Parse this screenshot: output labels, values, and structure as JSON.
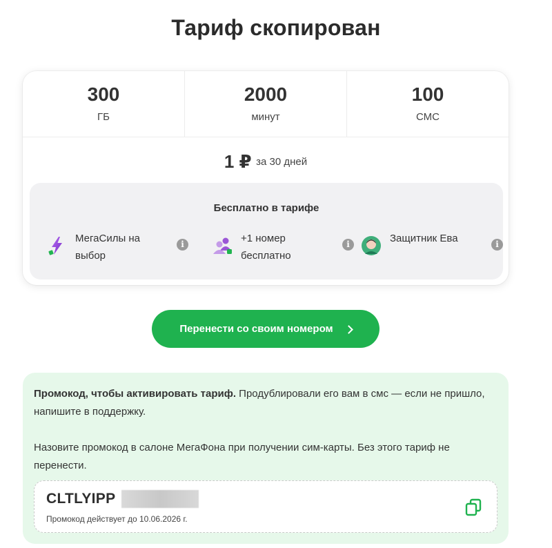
{
  "title": "Тариф скопирован",
  "stats": [
    {
      "value": "300",
      "unit": "ГБ"
    },
    {
      "value": "2000",
      "unit": "минут"
    },
    {
      "value": "100",
      "unit": "СМС"
    }
  ],
  "price": {
    "amount": "1 ₽",
    "period": "за 30 дней"
  },
  "free": {
    "title": "Бесплатно в тарифе",
    "features": [
      {
        "label": "МегаСилы на выбор",
        "icon": "lightning-icon"
      },
      {
        "label": "+1 номер бесплатно",
        "icon": "people-icon"
      },
      {
        "label": "Защитник Ева",
        "icon": "avatar-icon"
      }
    ],
    "info_glyph": "i"
  },
  "cta": {
    "label": "Перенести со своим номером"
  },
  "promo": {
    "lead_bold": "Промокод, чтобы активировать тариф.",
    "lead_rest": " Продублировали его вам в смс — если не пришло, напишите в поддержку.",
    "note": "Назовите промокод в салоне МегаФона при получении сим-карты. Без этого тариф не перенести.",
    "code": "CLTLYIPP",
    "valid": "Промокод действует до 10.06.2026 г."
  },
  "colors": {
    "accent": "#1fb24f",
    "promo_bg": "#e6f8ea",
    "purple": "#8a3fd1"
  }
}
